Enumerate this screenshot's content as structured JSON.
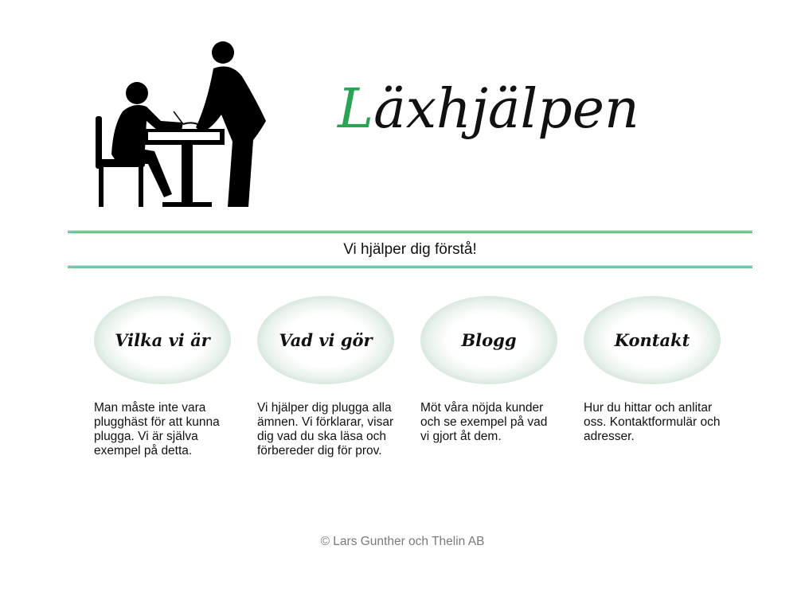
{
  "header": {
    "logo_icon": "student-and-teacher-at-desk-icon",
    "title_initial": "L",
    "title_rest": "äxhjälpen",
    "tagline": "Vi hjälper dig förstå!"
  },
  "colors": {
    "accent": "#2aa354",
    "rule": "#3d9a62",
    "footer_text": "#7a7a7a"
  },
  "nav": [
    {
      "label": "Vilka vi är",
      "description": "Man måste inte vara plugghäst för att kunna plugga. Vi är själva exempel på detta."
    },
    {
      "label": "Vad vi gör",
      "description": "Vi hjälper dig plugga alla ämnen. Vi förklarar, visar dig vad du ska läsa och förbereder dig för prov."
    },
    {
      "label": "Blogg",
      "description": "Möt våra nöjda kunder och se exempel på vad vi gjort åt dem."
    },
    {
      "label": "Kontakt",
      "description": "Hur du hittar och anlitar oss. Kontaktformulär och adresser."
    }
  ],
  "footer": {
    "copyright": "© Lars Gunther och Thelin AB"
  }
}
